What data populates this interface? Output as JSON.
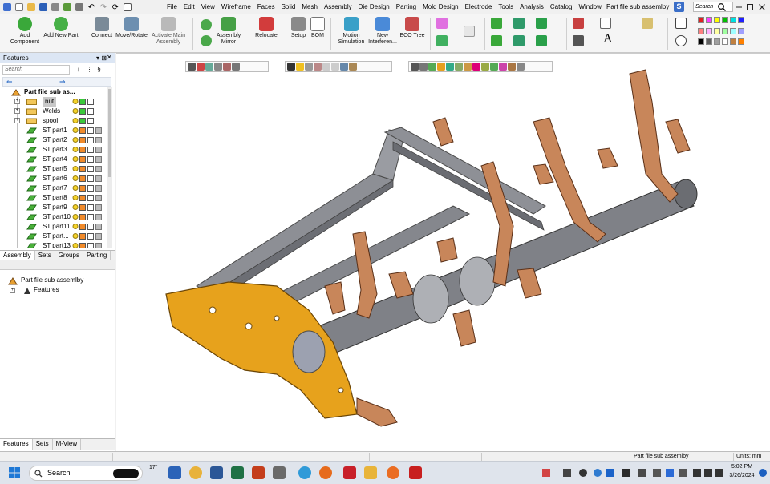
{
  "app": {
    "document_title": "Part file sub assemlby",
    "logo_letter": "S",
    "search_placeholder": "Search"
  },
  "menu": [
    "File",
    "Edit",
    "View",
    "Wireframe",
    "Faces",
    "Solid",
    "Mesh",
    "Assembly",
    "Die Design",
    "Parting",
    "Mold Design",
    "Electrode",
    "Tools",
    "Analysis",
    "Catalog",
    "Window"
  ],
  "ribbon": {
    "add_component": "Add\nComponent",
    "add_new_part": "Add New Part",
    "connect": "Connect",
    "move_rotate": "Move/Rotate",
    "activate_main": "Activate Main\nAssembly",
    "assembly_mirror": "Assembly\nMirror",
    "relocate": "Relocate",
    "setup": "Setup",
    "bom": "BOM",
    "motion_simulation": "Motion\nSimulation",
    "new_interference": "New\nInterferen...",
    "eco_tree": "ECO Tree",
    "palette_colors": [
      "#e02020",
      "#ff40ff",
      "#ffff00",
      "#00c000",
      "#00e0e0",
      "#2020ff",
      "#ff8080",
      "#ffb0ff",
      "#ffffa0",
      "#a0ffa0",
      "#a0ffff",
      "#a0a0ff",
      "#000000",
      "#606060",
      "#a0a0a0",
      "#ffffff",
      "#c08040",
      "#ff8000"
    ]
  },
  "features_panel": {
    "title": "Features",
    "pin": "▾ ⊠",
    "close": "✕",
    "search_placeholder": "Search",
    "tool1": "↓",
    "tool2": "§",
    "tool3": "⋮",
    "nav_back": "⇐",
    "nav_forward": "⇒",
    "root": "Part file sub as...",
    "items": [
      {
        "label": "nut",
        "kind": "folder",
        "selected": true
      },
      {
        "label": "Welds",
        "kind": "folder"
      },
      {
        "label": "spool",
        "kind": "folder"
      },
      {
        "label": "ST part1",
        "kind": "part"
      },
      {
        "label": "ST part2",
        "kind": "part"
      },
      {
        "label": "ST part3",
        "kind": "part"
      },
      {
        "label": "ST part4",
        "kind": "part"
      },
      {
        "label": "ST part5",
        "kind": "part"
      },
      {
        "label": "ST part6",
        "kind": "part"
      },
      {
        "label": "ST part7",
        "kind": "part"
      },
      {
        "label": "ST part8",
        "kind": "part"
      },
      {
        "label": "ST part9",
        "kind": "part"
      },
      {
        "label": "ST part10",
        "kind": "part"
      },
      {
        "label": "ST part11",
        "kind": "part"
      },
      {
        "label": "ST part...",
        "kind": "part"
      },
      {
        "label": "ST part13",
        "kind": "part"
      }
    ],
    "tabs": [
      "Assembly",
      "Sets",
      "Groups",
      "Parting"
    ],
    "tree2_root": "Part file sub assemlby",
    "tree2_child": "Features",
    "bottom_tabs": [
      "Features",
      "Sets",
      "M-View"
    ]
  },
  "status": {
    "file": "Part file sub assemlby",
    "units": "Units: mm"
  },
  "taskbar": {
    "search_label": "Search",
    "weather": "17°",
    "time": "5:02 PM",
    "date": "3/26/2024"
  }
}
